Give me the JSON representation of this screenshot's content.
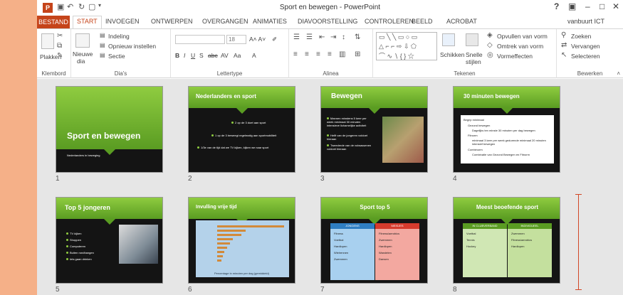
{
  "title_bar": {
    "logo": "P",
    "doc_title": "Sport en bewegen - PowerPoint",
    "help": "?",
    "display_options": "▣",
    "minimize": "–",
    "restore": "□",
    "close": "✕"
  },
  "tabs": [
    "BESTAND",
    "START",
    "INVOEGEN",
    "ONTWERPEN",
    "OVERGANGEN",
    "ANIMATIES",
    "DIAVOORSTELLING",
    "CONTROLEREN",
    "BEELD",
    "ACROBAT"
  ],
  "account": "vanbuurt ICT",
  "ribbon": {
    "clipboard": {
      "label": "Klembord",
      "paste": "Plakken"
    },
    "slides": {
      "label": "Dia's",
      "new_slide_1": "Nieuwe",
      "new_slide_2": "dia",
      "layout": "Indeling",
      "reset": "Opnieuw instellen",
      "section": "Sectie"
    },
    "font": {
      "label": "Lettertype",
      "size": "18"
    },
    "paragraph": {
      "label": "Alinea"
    },
    "drawing": {
      "label": "Tekenen",
      "arrange": "Schikken",
      "quick_styles_1": "Snelle",
      "quick_styles_2": "stijlen",
      "fill": "Opvullen van vorm",
      "outline": "Omtrek van vorm",
      "effects": "Vormeffecten"
    },
    "editing": {
      "label": "Bewerken",
      "find": "Zoeken",
      "replace": "Vervangen",
      "select": "Selecteren"
    }
  },
  "slides": [
    {
      "number": "1",
      "title": "Sport en bewegen",
      "subtitle": "Nederlanders in beweging"
    },
    {
      "number": "2",
      "title": "Nederlanders en sport",
      "bullets": [
        "2 op de 3 doet aan sport",
        "1 op de 3 beweegt regelmatig aan sportmobiliteit",
        "1/3e van de tijd dat we TV kijken, kijken we naar sport"
      ]
    },
    {
      "number": "3",
      "title": "Bewegen",
      "bullets": [
        "Mannen minstens 5 keer per week minimaal 30 minuten intensieve lichamelijke activiteit",
        "Helft van de jongeren voldoet hieraan",
        "Tweederde van de volwassenen voldoet hieraan"
      ]
    },
    {
      "number": "4",
      "title": "30 minuten bewegen",
      "bullets": [
        "Begrip minimaal",
        "Gezond bewegen",
        "Dagelijks ten minste 30 minuten per dag bewegen",
        "Fitnorm",
        "minimaal 3 keer per week gedurende minimaal 20 minuten intensief bewegen",
        "Combinorm",
        "Combinatie van Gezond Bewegen en Fitnorm"
      ]
    },
    {
      "number": "5",
      "title": "Top 5 jongeren",
      "bullets": [
        "TV kijken",
        "Shoppen",
        "Computeren",
        "Buiten rondhangen",
        "Iets gaan drinken"
      ]
    },
    {
      "number": "6",
      "title": "Invulling vrije tijd",
      "legend": "Percentage in minuten per dag (gemiddeld)"
    },
    {
      "number": "7",
      "title": "Sport top 5",
      "col1": "JONGENS",
      "col2": "MEISJES",
      "col1_items": [
        "Fitness",
        "Voetbal",
        "Hardlopen",
        "Wielrennen",
        "Zwemmen"
      ],
      "col2_items": [
        "Fitness/aerobics",
        "Zwemmen",
        "Hardlopen",
        "Wandelen",
        "Dansen"
      ]
    },
    {
      "number": "8",
      "title": "Meest beoefende sport",
      "col1": "IN CLUBVERBAND",
      "col2": "INDIVIDUEEL",
      "col1_items": [
        "Voetbal",
        "Tennis",
        "Hockey"
      ],
      "col2_items": [
        "Zwemmen",
        "Fitness/aerobics",
        "Hardlopen"
      ]
    }
  ],
  "colors": {
    "accent": "#c5441a",
    "slide_green": "#6bb02e",
    "slide_dark": "#141414"
  }
}
